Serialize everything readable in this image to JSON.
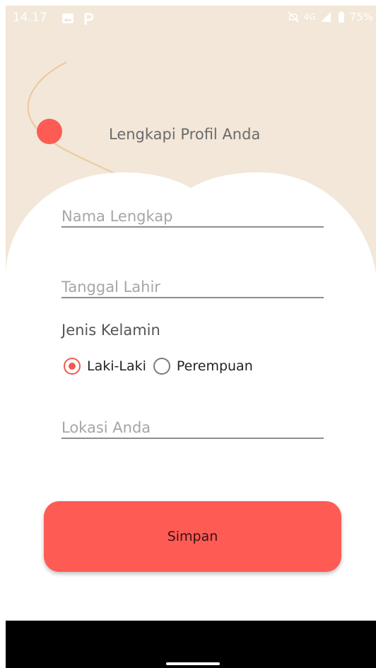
{
  "status_bar": {
    "time": "14.17",
    "network": "4G",
    "battery": "75%"
  },
  "page": {
    "title": "Lengkapi Profil Anda"
  },
  "form": {
    "full_name": {
      "placeholder": "Nama Lengkap",
      "value": ""
    },
    "birth_date": {
      "placeholder": "Tanggal Lahir",
      "value": ""
    },
    "gender": {
      "label": "Jenis Kelamin",
      "options": [
        "Laki-Laki",
        "Perempuan"
      ],
      "selected": "Laki-Laki"
    },
    "location": {
      "placeholder": "Lokasi Anda",
      "value": ""
    }
  },
  "actions": {
    "save_label": "Simpan"
  },
  "colors": {
    "background": "#f2e7d8",
    "accent": "#fe5b55",
    "card": "#ffffff"
  }
}
